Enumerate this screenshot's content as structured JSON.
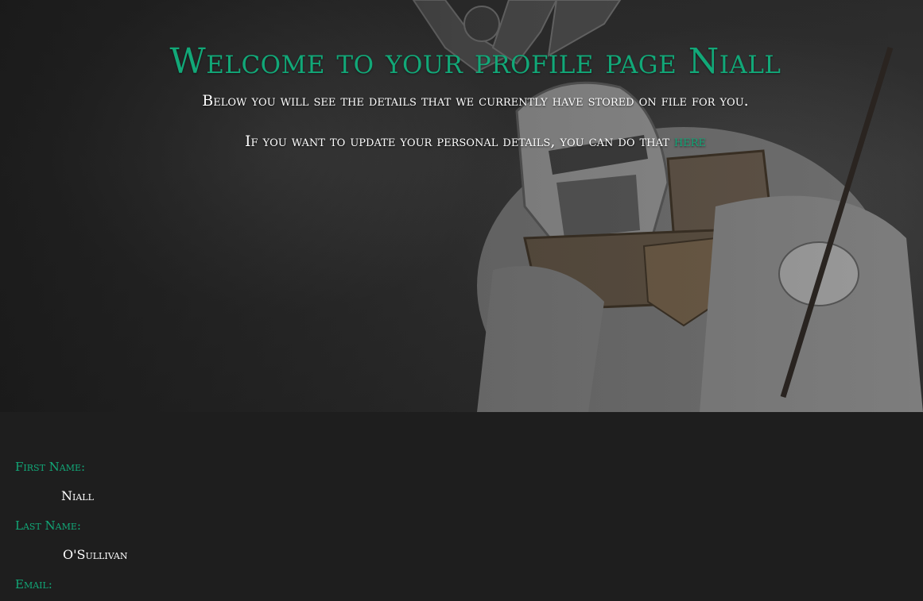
{
  "hero": {
    "title": "Welcome to your profile page Niall",
    "line1": "Below you will see the details that we currently have stored on file for you.",
    "line2_prefix": "If you want to update your personal details, you can do that ",
    "line2_link": "here"
  },
  "profile": {
    "first_name_label": "First Name:",
    "first_name_value": "Niall",
    "last_name_label": "Last Name:",
    "last_name_value": "O'Sullivan",
    "email_label": "Email:"
  },
  "colors": {
    "accent": "#12a878",
    "background": "#1e1e1e",
    "text": "#ffffff"
  }
}
